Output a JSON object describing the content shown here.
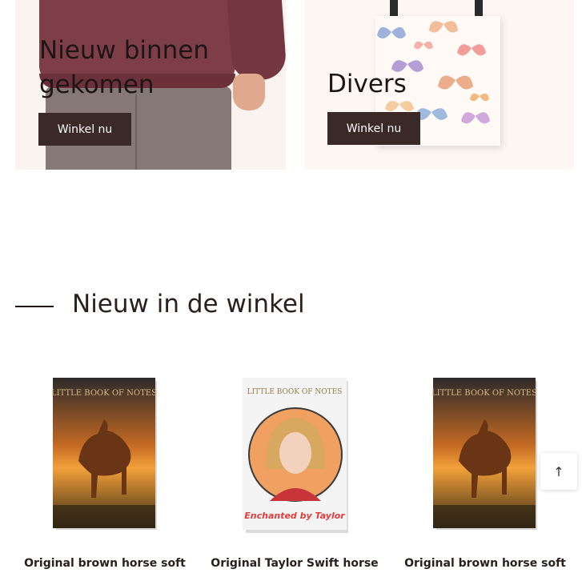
{
  "promos": [
    {
      "title": "Nieuw binnen gekomen",
      "button": "Winkel nu"
    },
    {
      "title": "Divers",
      "button": "Winkel nu"
    }
  ],
  "section": {
    "title": "Nieuw in de winkel"
  },
  "products": [
    {
      "name": "Original brown horse soft",
      "cover_text": "LITTLE BOOK OF NOTES"
    },
    {
      "name": "Original Taylor Swift horse",
      "cover_text": "LITTLE BOOK OF NOTES",
      "cover_caption": "Enchanted by Taylor"
    },
    {
      "name": "Original brown horse soft",
      "cover_text": "LITTLE BOOK OF NOTES"
    }
  ],
  "scroll_top": {
    "label": "↑"
  },
  "colors": {
    "button_bg": "#3a2926",
    "sweater": "#7d3e47",
    "promo_bg": "#fbf3ef",
    "text": "#2b201d"
  }
}
